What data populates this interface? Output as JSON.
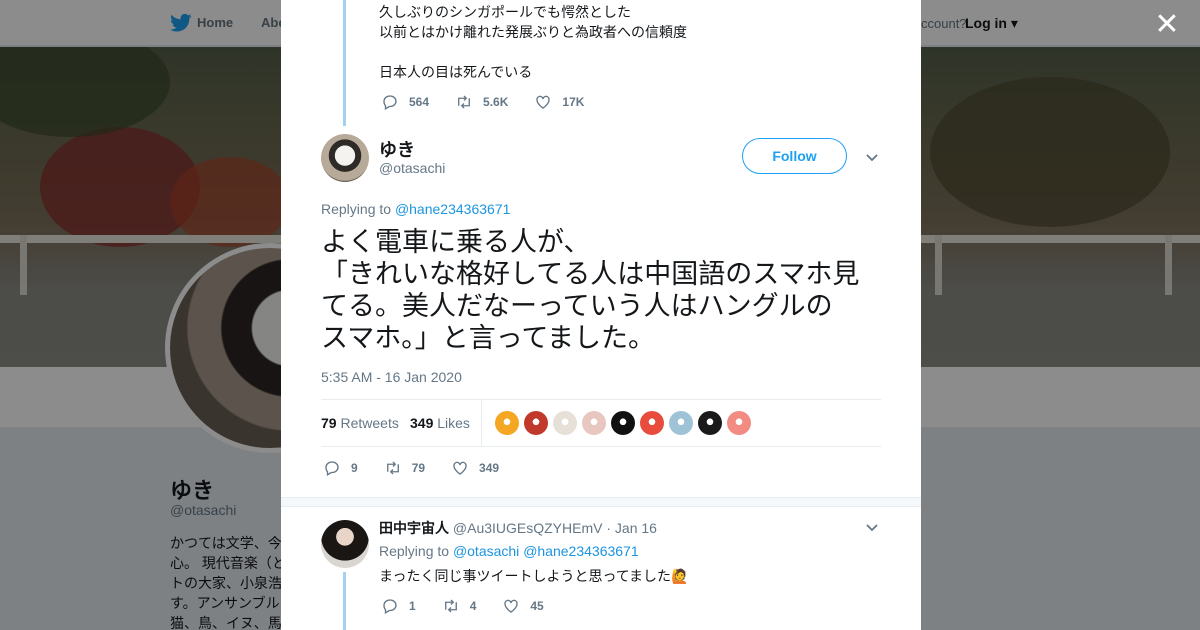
{
  "nav": {
    "home_label": "Home",
    "about_label": "Abo",
    "account_prompt": "ccount?",
    "login_label": "Log in"
  },
  "profile": {
    "name": "ゆき",
    "handle": "@otasachi",
    "bio_lines": [
      "かつては文学、今",
      "心。 現代音楽（と",
      "トの大家、小泉浩",
      "す。アンサンブル",
      "猫、鳥、イヌ、馬"
    ]
  },
  "previous_tweet": {
    "lines": [
      "久しぶりのシンガポールでも愕然とした",
      "以前とはかけ離れた発展ぶりと為政者への信頼度",
      "",
      "日本人の目は死んでいる"
    ],
    "replies": "564",
    "retweets": "5.6K",
    "likes": "17K"
  },
  "main_tweet": {
    "display_name": "ゆき",
    "handle": "@otasachi",
    "follow_label": "Follow",
    "replying_prefix": "Replying to",
    "replying_to": "@hane234363671",
    "text_lines": [
      "よく電車に乗る人が、",
      "「きれいな格好してる人は中国語のスマホ見",
      "てる。美人だなーっていう人はハングルの",
      "スマホ。」と言ってました。"
    ],
    "timestamp": "5:35 AM - 16 Jan 2020",
    "retweet_count": "79",
    "retweet_label": "Retweets",
    "like_count": "349",
    "like_label": "Likes",
    "reply_action_count": "9",
    "retweet_action_count": "79",
    "like_action_count": "349",
    "liker_colors": [
      "#f5a623",
      "#c0392b",
      "#e6e0d8",
      "#e8c7c0",
      "#111111",
      "#e84c3d",
      "#9fc3d6",
      "#1a1a1a",
      "#f28b82"
    ]
  },
  "reply_tweet": {
    "display_name": "田中宇宙人",
    "handle": "@Au3IUGEsQZYHEmV",
    "date": "· Jan 16",
    "replying_prefix": "Replying to",
    "replying_to_1": "@otasachi",
    "replying_to_2": "@hane234363671",
    "text": "まったく同じ事ツイートしようと思ってました🙋",
    "replies": "1",
    "retweets": "4",
    "likes": "45"
  },
  "colors": {
    "accent": "#1da1f2",
    "link": "#1b95e0",
    "muted": "#657786",
    "thread_line": "#a3d1f2"
  }
}
